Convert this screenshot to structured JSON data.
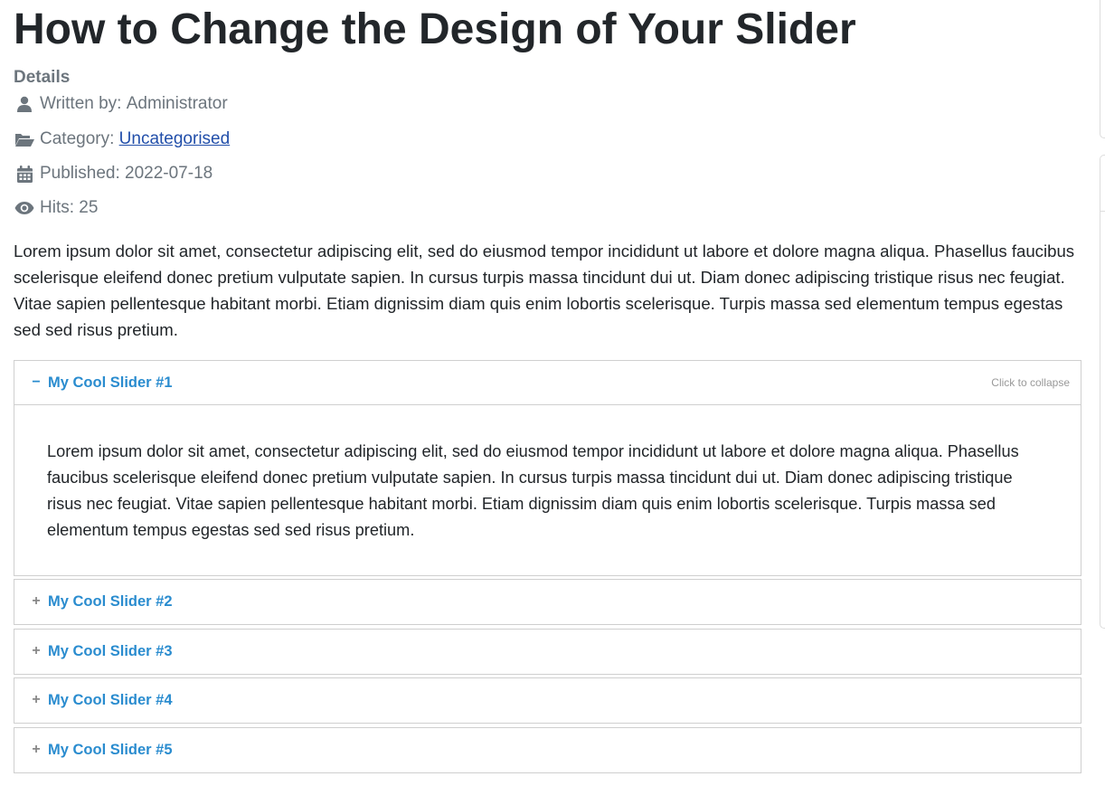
{
  "article": {
    "title": "How to Change the Design of Your Slider",
    "details_heading": "Details",
    "author": {
      "label": "Written by:",
      "value": "Administrator"
    },
    "category": {
      "label": "Category:",
      "value": "Uncategorised"
    },
    "published": {
      "label": "Published:",
      "value": "2022-07-18"
    },
    "hits": {
      "label": "Hits:",
      "value": "25"
    },
    "intro": "Lorem ipsum dolor sit amet, consectetur adipiscing elit, sed do eiusmod tempor incididunt ut labore et dolore magna aliqua. Phasellus faucibus scelerisque eleifend donec pretium vulputate sapien. In cursus turpis massa tincidunt dui ut. Diam donec adipiscing tristique risus nec feugiat. Vitae sapien pellentesque habitant morbi. Etiam dignissim diam quis enim lobortis scelerisque. Turpis massa sed elementum tempus egestas sed sed risus pretium."
  },
  "sliders": [
    {
      "toggle": "−",
      "title": "My Cool Slider #1",
      "hint": "Click to collapse",
      "expanded": true,
      "body": "Lorem ipsum dolor sit amet, consectetur adipiscing elit, sed do eiusmod tempor incididunt ut labore et dolore magna aliqua. Phasellus faucibus scelerisque eleifend donec pretium vulputate sapien. In cursus turpis massa tincidunt dui ut. Diam donec adipiscing tristique risus nec feugiat. Vitae sapien pellentesque habitant morbi. Etiam dignissim diam quis enim lobortis scelerisque. Turpis massa sed elementum tempus egestas sed sed risus pretium."
    },
    {
      "toggle": "+",
      "title": "My Cool Slider #2",
      "expanded": false
    },
    {
      "toggle": "+",
      "title": "My Cool Slider #3",
      "expanded": false
    },
    {
      "toggle": "+",
      "title": "My Cool Slider #4",
      "expanded": false
    },
    {
      "toggle": "+",
      "title": "My Cool Slider #5",
      "expanded": false
    }
  ],
  "colors": {
    "heading": "#22262a",
    "meta_text": "#6c757d",
    "link": "#224faa",
    "slider_title": "#2a8ccf",
    "border": "#cfcfcf"
  },
  "icons": {
    "author": "user-icon",
    "category": "folder-open-icon",
    "published": "calendar-icon",
    "hits": "eye-icon"
  }
}
